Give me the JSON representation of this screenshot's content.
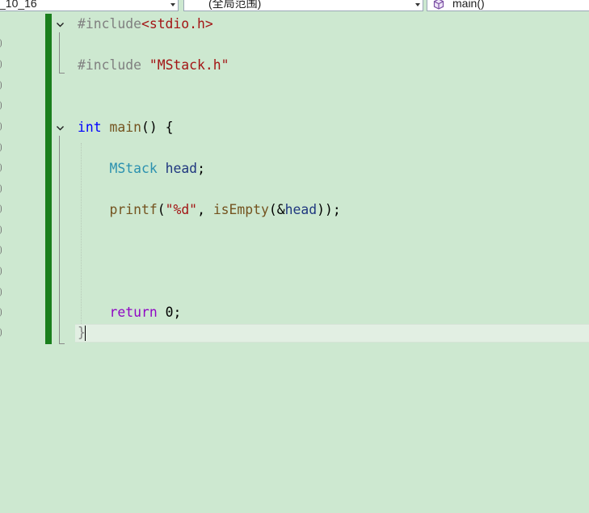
{
  "navbar": {
    "project": "_10_16",
    "scope": "(全局范围)",
    "member": "main()",
    "member_icon": "cube-icon"
  },
  "editor": {
    "background": "#cde8d0",
    "change_marker_color": "#1a7f1d",
    "lines": [
      [
        {
          "t": "#include",
          "c": "pre"
        },
        {
          "t": "<stdio.h>",
          "c": "inc"
        }
      ],
      [],
      [
        {
          "t": "#include",
          "c": "pre"
        },
        {
          "t": " ",
          "c": "plain"
        },
        {
          "t": "\"MStack.h\"",
          "c": "str"
        }
      ],
      [],
      [],
      [
        {
          "t": "int",
          "c": "kw"
        },
        {
          "t": " ",
          "c": "plain"
        },
        {
          "t": "main",
          "c": "fn"
        },
        {
          "t": "() {",
          "c": "plain"
        }
      ],
      [],
      [
        {
          "t": "    ",
          "c": "plain"
        },
        {
          "t": "MStack",
          "c": "type"
        },
        {
          "t": " ",
          "c": "plain"
        },
        {
          "t": "head",
          "c": "var"
        },
        {
          "t": ";",
          "c": "plain"
        }
      ],
      [],
      [
        {
          "t": "    ",
          "c": "plain"
        },
        {
          "t": "printf",
          "c": "fn"
        },
        {
          "t": "(",
          "c": "plain"
        },
        {
          "t": "\"%d\"",
          "c": "str"
        },
        {
          "t": ", ",
          "c": "plain"
        },
        {
          "t": "isEmpty",
          "c": "fn"
        },
        {
          "t": "(&",
          "c": "plain"
        },
        {
          "t": "head",
          "c": "var"
        },
        {
          "t": "));",
          "c": "plain"
        }
      ],
      [],
      [],
      [],
      [],
      [
        {
          "t": "    ",
          "c": "plain"
        },
        {
          "t": "return",
          "c": "ctrl"
        },
        {
          "t": " 0;",
          "c": "plain"
        }
      ],
      [
        {
          "t": "}",
          "c": "brace"
        }
      ]
    ]
  }
}
